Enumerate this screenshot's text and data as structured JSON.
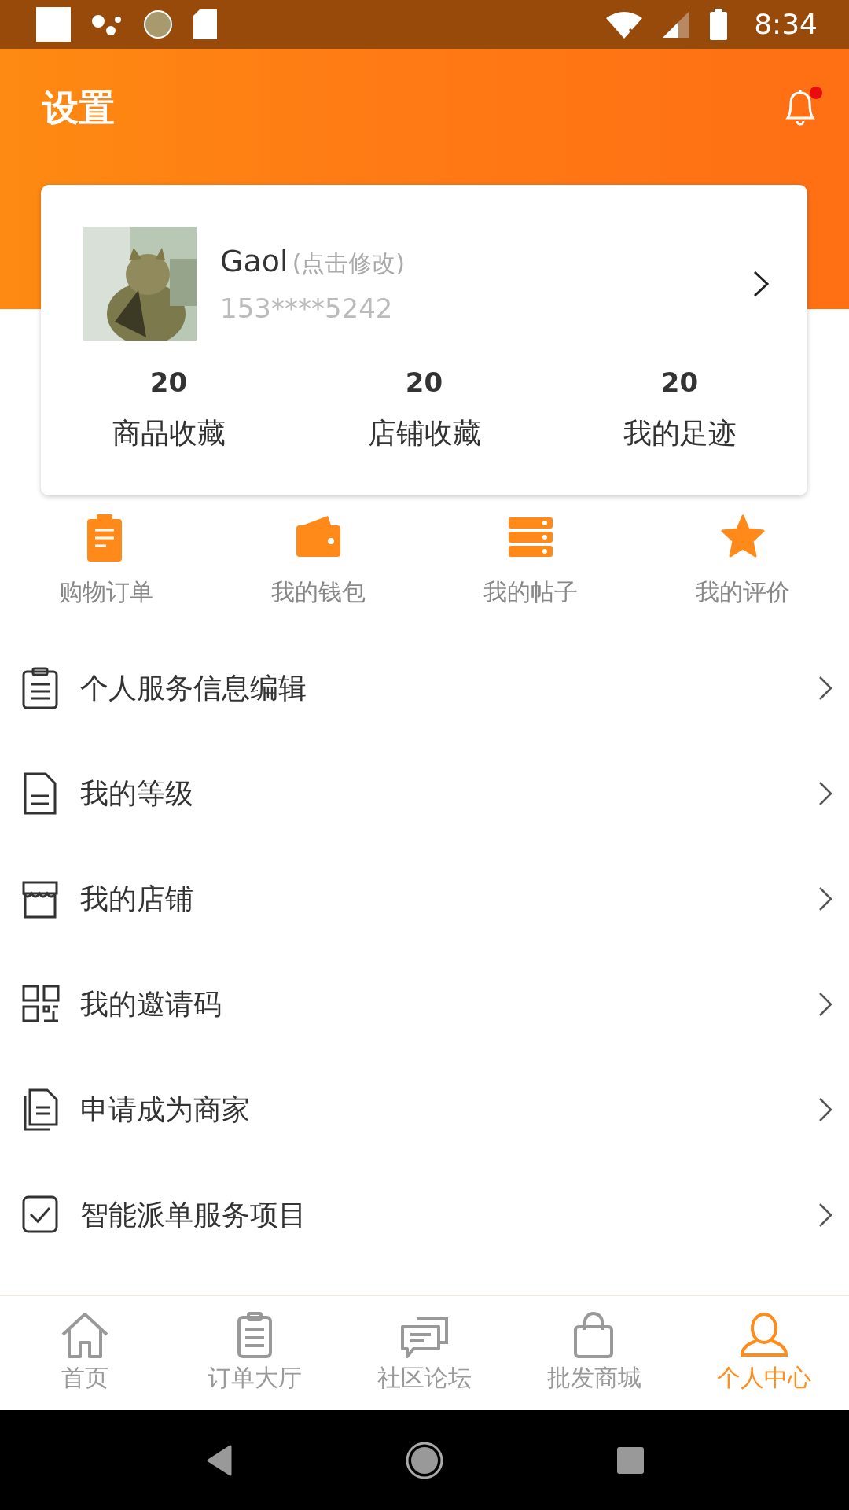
{
  "status_bar": {
    "time": "8:34"
  },
  "header": {
    "title": "设置",
    "notification_dot": true
  },
  "profile": {
    "name": "Gaol",
    "edit_hint": "(点击修改)",
    "phone": "153****5242",
    "stats": [
      {
        "value": "20",
        "label": "商品收藏"
      },
      {
        "value": "20",
        "label": "店铺收藏"
      },
      {
        "value": "20",
        "label": "我的足迹"
      }
    ]
  },
  "quick_actions": [
    {
      "label": "购物订单"
    },
    {
      "label": "我的钱包"
    },
    {
      "label": "我的帖子"
    },
    {
      "label": "我的评价"
    }
  ],
  "menu_items": [
    {
      "label": "个人服务信息编辑"
    },
    {
      "label": "我的等级"
    },
    {
      "label": "我的店铺"
    },
    {
      "label": "我的邀请码"
    },
    {
      "label": "申请成为商家"
    },
    {
      "label": "智能派单服务项目"
    }
  ],
  "tab_bar": [
    {
      "label": "首页",
      "selected": false
    },
    {
      "label": "订单大厅",
      "selected": false
    },
    {
      "label": "社区论坛",
      "selected": false
    },
    {
      "label": "批发商城",
      "selected": false
    },
    {
      "label": "个人中心",
      "selected": true
    }
  ]
}
